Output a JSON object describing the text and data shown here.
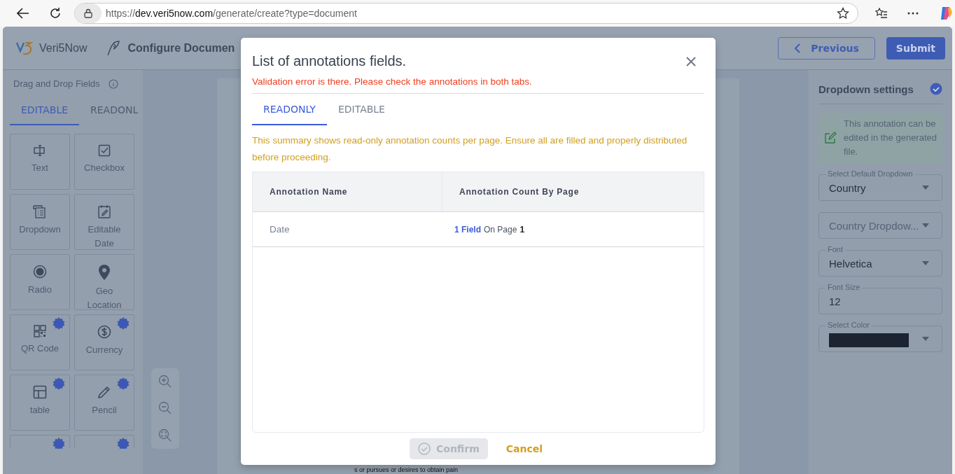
{
  "browser": {
    "url": {
      "scheme": "https://",
      "host": "dev.veri5now.com",
      "path": "/generate/create?type=document"
    }
  },
  "header": {
    "logo": "Veri5Now",
    "title": "Configure Documen",
    "previous": "Previous",
    "submit": "Submit"
  },
  "sidebar": {
    "title": "Drag and Drop Fields",
    "tabs": [
      {
        "label": "EDITABLE",
        "selected": true
      },
      {
        "label": "READONL",
        "selected": false
      }
    ],
    "tiles": [
      {
        "kind": "text",
        "label": "Text",
        "new": false
      },
      {
        "kind": "checkbox",
        "label": "Checkbox",
        "new": false
      },
      {
        "kind": "dropdown",
        "label": "Dropdown",
        "new": false
      },
      {
        "kind": "date",
        "label": "Editable Date",
        "new": false
      },
      {
        "kind": "radio",
        "label": "Radio",
        "new": false
      },
      {
        "kind": "location",
        "label": "Geo Location",
        "new": false
      },
      {
        "kind": "qr",
        "label": "QR Code",
        "new": true
      },
      {
        "kind": "currency",
        "label": "Currency",
        "new": true
      },
      {
        "kind": "table",
        "label": "table",
        "new": true
      },
      {
        "kind": "pencil",
        "label": "Pencil",
        "new": true
      },
      {
        "kind": "cut",
        "new": true
      },
      {
        "kind": "cut",
        "new": true
      }
    ]
  },
  "canvas": {
    "page_text": "s or pursues or desires to obtain pain"
  },
  "settings": {
    "title": "Dropdown settings",
    "note": "This annotation can be edited in the generated file.",
    "fields": [
      {
        "kind": "select",
        "label": "Select Default Dropdown",
        "value": "Country"
      },
      {
        "kind": "select",
        "placeholder": "Country Dropdow..."
      },
      {
        "kind": "select",
        "label": "Font",
        "value": "Helvetica"
      },
      {
        "kind": "input",
        "label": "Font Size",
        "value": "12"
      },
      {
        "kind": "color",
        "label": "Select Color",
        "color": "#1b2430"
      }
    ]
  },
  "modal": {
    "title": "List of annotations fields.",
    "error": "Validation error is there. Please check the annotations in both tabs.",
    "tabs": [
      {
        "label": "READONLY",
        "selected": true
      },
      {
        "label": "EDITABLE",
        "selected": false
      }
    ],
    "note": "This summary shows read-only annotation counts per page. Ensure all are filled and properly distributed before proceeding.",
    "columns": [
      "Annotation Name",
      "Annotation Count By Page"
    ],
    "rows": [
      {
        "name": "Date",
        "count": "1 Field",
        "on_page": "On Page",
        "page": "1"
      }
    ],
    "confirm": {
      "label": "Confirm",
      "disabled": true
    },
    "cancel": "Cancel"
  }
}
